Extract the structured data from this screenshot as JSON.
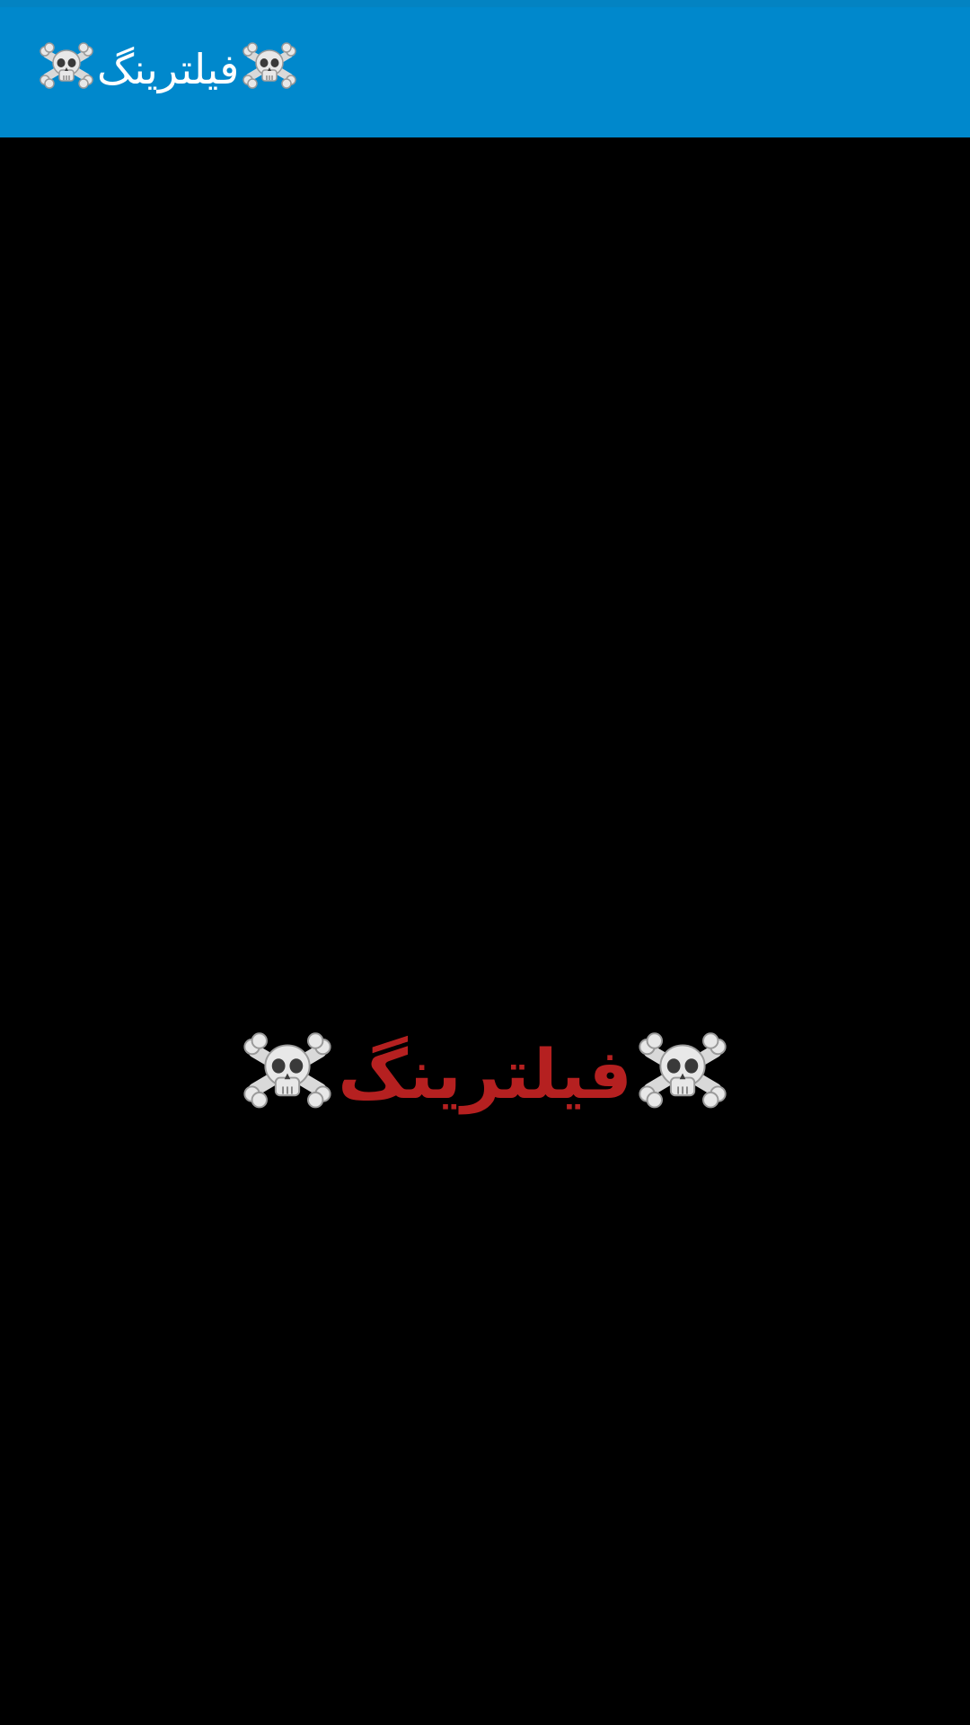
{
  "app_bar": {
    "title": "فیلترینگ",
    "background_color": "#0088cc",
    "title_color": "#ffffff",
    "leading_icon": "skull-crossbones-icon",
    "trailing_icon": "skull-crossbones-icon"
  },
  "main": {
    "background_color": "#000000",
    "banner": {
      "text": "فیلترینگ",
      "color": "#b52020",
      "leading_icon": "skull-crossbones-icon",
      "trailing_icon": "skull-crossbones-icon"
    }
  }
}
